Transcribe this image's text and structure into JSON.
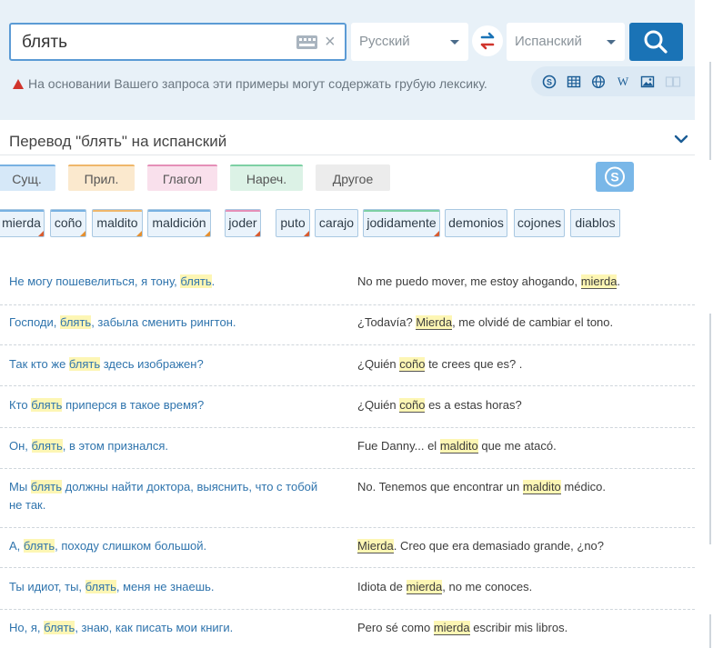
{
  "search": {
    "query": "блять",
    "source_lang": "Русский",
    "target_lang": "Испанский"
  },
  "warning": "На основании Вашего запроса эти примеры могут содержать грубую лексику.",
  "header": {
    "title": "Перевод \"блять\" на испанский"
  },
  "pos_filters": [
    "Сущ.",
    "Прил.",
    "Глагол",
    "Нареч.",
    "Другое"
  ],
  "translations": [
    "mierda",
    "coño",
    "maldito",
    "maldición",
    "joder",
    "puto",
    "carajo",
    "jodidamente",
    "demonios",
    "cojones",
    "diablos"
  ],
  "examples": [
    {
      "src": [
        "Не могу пошевелиться, я тону, ",
        "блять",
        "."
      ],
      "tgt": [
        "No me puedo mover, me estoy ahogando, ",
        "mierda",
        "."
      ]
    },
    {
      "src": [
        "Господи, ",
        "блять",
        ", забыла сменить рингтон."
      ],
      "tgt": [
        "¿Todavía? ",
        "Mierda",
        ", me olvidé de cambiar el tono."
      ]
    },
    {
      "src": [
        "Так кто же ",
        "блять",
        " здесь изображен?"
      ],
      "tgt": [
        "¿Quién ",
        "coño",
        " te crees que es? ."
      ]
    },
    {
      "src": [
        "Кто ",
        "блять",
        " приперся в такое время?"
      ],
      "tgt": [
        "¿Quién ",
        "coño",
        " es a estas horas?"
      ]
    },
    {
      "src": [
        "Он, ",
        "блять",
        ", в этом признался."
      ],
      "tgt": [
        "Fue Danny... el ",
        "maldito",
        " que me atacó."
      ]
    },
    {
      "src": [
        "Мы ",
        "блять",
        " должны найти доктора, выяснить, что с тобой не так."
      ],
      "tgt": [
        "No. Tenemos que encontrar un ",
        "maldito",
        " médico."
      ]
    },
    {
      "src": [
        "А, ",
        "блять",
        ", походу слишком большой."
      ],
      "tgt": [
        "",
        "Mierda",
        ". Creo que era demasiado grande, ¿no?"
      ]
    },
    {
      "src": [
        "Ты идиот, ты, ",
        "блять",
        ", меня не знаешь."
      ],
      "tgt": [
        "Idiota de ",
        "mierda",
        ", no me conoces."
      ]
    },
    {
      "src": [
        "Но, я, ",
        "блять",
        ", знаю, как писать мои книги."
      ],
      "tgt": [
        "Pero sé como ",
        "mierda",
        " escribir mis libros."
      ]
    }
  ],
  "colors": {
    "accent": "#1a73b6",
    "highlight": "#fdf6b4",
    "source_text": "#2f74ad"
  }
}
